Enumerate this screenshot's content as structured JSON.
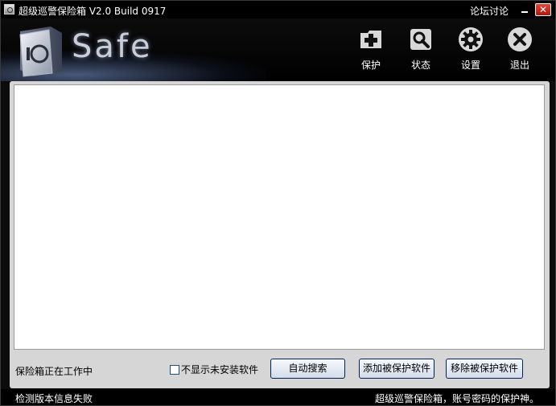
{
  "window": {
    "title": "超级巡警保险箱 V2.0 Build 0917",
    "forum_link": "论坛讨论",
    "minimize_label": "",
    "close_label": "✕"
  },
  "header": {
    "brand": "Safe",
    "logo_text": "IO",
    "toolbar": [
      {
        "label": "保护",
        "icon": "add-icon"
      },
      {
        "label": "状态",
        "icon": "search-icon"
      },
      {
        "label": "设置",
        "icon": "gear-icon"
      },
      {
        "label": "退出",
        "icon": "close-icon"
      }
    ]
  },
  "main": {
    "list_rows": [],
    "status_text": "保险箱正在工作中",
    "checkbox_label": "不显示未安装软件",
    "checkbox_checked": false,
    "buttons": {
      "auto_search": "自动搜索",
      "add_protected": "添加被保护软件",
      "remove_protected": "移除被保护软件"
    }
  },
  "statusbar": {
    "left": "检测版本信息失败",
    "right": "超级巡警保险箱，账号密码的保护神。"
  },
  "colors": {
    "background": "#0c0c0c",
    "panel": "#d6d6d6",
    "close_button": "#c8271b",
    "button_border": "#00215a"
  }
}
